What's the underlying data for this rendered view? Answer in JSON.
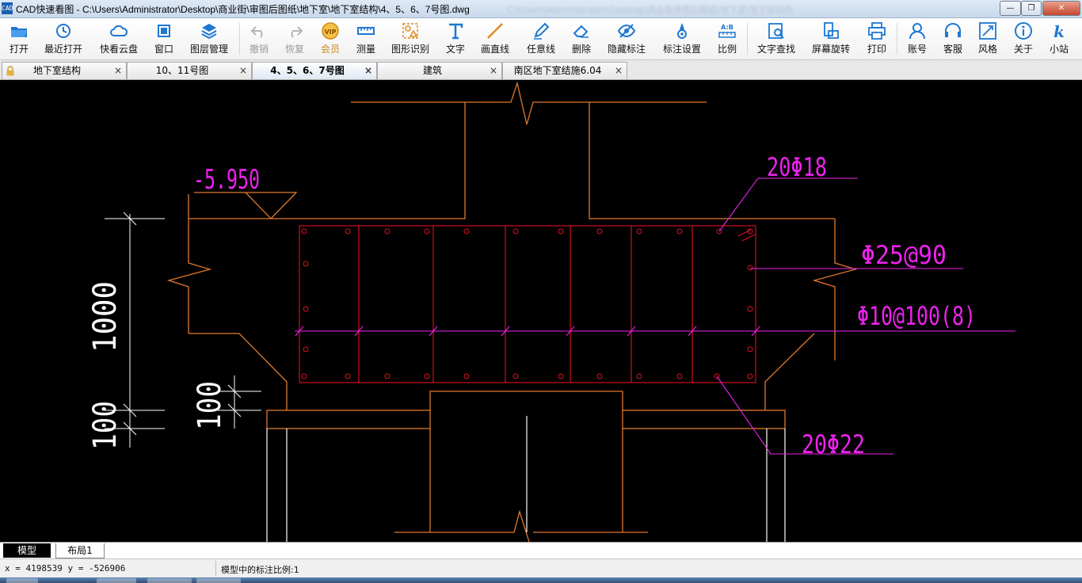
{
  "window": {
    "title": "CAD快速看图 - C:\\Users\\Administrator\\Desktop\\商业街\\审图后图纸\\地下室\\地下室结构\\4、5、6、7号图.dwg",
    "app_icon_label": "CAD",
    "minimize": "—",
    "maximize": "❐",
    "close": "✕"
  },
  "toolbar": [
    {
      "label": "打开",
      "icon": "folder-icon",
      "enabled": true
    },
    {
      "label": "最近打开",
      "icon": "recent-clock-icon",
      "enabled": true
    },
    {
      "label": "快看云盘",
      "icon": "cloud-icon",
      "enabled": true
    },
    {
      "label": "窗口",
      "icon": "window-icon",
      "enabled": true
    },
    {
      "label": "图层管理",
      "icon": "layers-icon",
      "enabled": true
    },
    {
      "label": "撤销",
      "icon": "undo-icon",
      "enabled": false
    },
    {
      "label": "恢复",
      "icon": "redo-icon",
      "enabled": false
    },
    {
      "label": "会员",
      "icon": "vip-icon",
      "enabled": true
    },
    {
      "label": "测量",
      "icon": "ruler-icon",
      "enabled": true
    },
    {
      "label": "图形识别",
      "icon": "shape-recognition-icon",
      "enabled": true
    },
    {
      "label": "文字",
      "icon": "text-icon",
      "enabled": true
    },
    {
      "label": "画直线",
      "icon": "line-icon",
      "enabled": true
    },
    {
      "label": "任意线",
      "icon": "pen-icon",
      "enabled": true
    },
    {
      "label": "删除",
      "icon": "eraser-icon",
      "enabled": true
    },
    {
      "label": "隐藏标注",
      "icon": "hide-eye-icon",
      "enabled": true
    },
    {
      "label": "标注设置",
      "icon": "annotation-settings-icon",
      "enabled": true
    },
    {
      "label": "比例",
      "icon": "scale-icon",
      "enabled": true
    },
    {
      "label": "文字查找",
      "icon": "text-search-icon",
      "enabled": true
    },
    {
      "label": "屏幕旋转",
      "icon": "rotate-screen-icon",
      "enabled": true
    },
    {
      "label": "打印",
      "icon": "printer-icon",
      "enabled": true
    },
    {
      "label": "账号",
      "icon": "user-icon",
      "enabled": true
    },
    {
      "label": "客服",
      "icon": "headset-icon",
      "enabled": true
    },
    {
      "label": "风格",
      "icon": "style-icon",
      "enabled": true
    },
    {
      "label": "关于",
      "icon": "info-icon",
      "enabled": true
    },
    {
      "label": "小站",
      "icon": "k-station-icon",
      "enabled": true
    }
  ],
  "tabs": [
    {
      "label": "地下室结构",
      "active": false,
      "locked": true
    },
    {
      "label": "10、11号图",
      "active": false,
      "locked": false
    },
    {
      "label": "4、5、6、7号图",
      "active": true,
      "locked": false
    },
    {
      "label": "建筑",
      "active": false,
      "locked": false
    },
    {
      "label": "南区地下室结施6.04",
      "active": false,
      "locked": false
    }
  ],
  "tab_close_glyph": "×",
  "drawing": {
    "elevation": "-5.950",
    "rebar_top": "20Φ18",
    "rebar_side": "Φ25@90",
    "stirrup": "Φ10@100(8)",
    "rebar_bottom": "20Φ22",
    "dim_height": "1000",
    "dim_100_left": "100",
    "dim_100_right": "100",
    "colors": {
      "structure": "#e0782c",
      "rebar": "#e01020",
      "annotation": "#ee22ee",
      "dimension": "#ffffff"
    }
  },
  "layouts": [
    {
      "label": "模型",
      "active": true
    },
    {
      "label": "布局1",
      "active": false
    }
  ],
  "status": {
    "coords": "x = 4198539  y = -526906",
    "scale_message": "模型中的标注比例:1"
  }
}
